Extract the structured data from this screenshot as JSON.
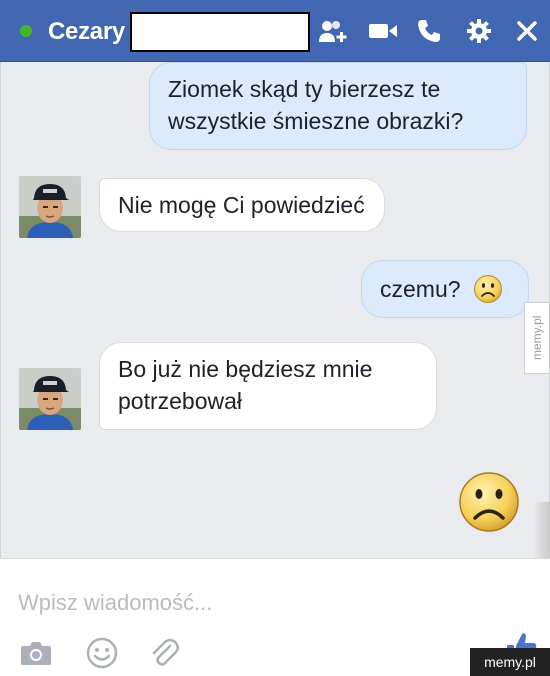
{
  "header": {
    "contact_name": "Cezary",
    "status": "online",
    "icons": [
      "add-person-icon",
      "video-camera-icon",
      "phone-icon",
      "gear-icon",
      "close-icon"
    ],
    "colors": {
      "bar": "#4267b2",
      "online": "#42b72a"
    }
  },
  "messages": [
    {
      "direction": "out",
      "text_line1": "Ziomek skąd ty bierzesz te",
      "text_line2": "wszystkie śmieszne obrazki?"
    },
    {
      "direction": "in",
      "text": "Nie mogę Ci powiedzieć"
    },
    {
      "direction": "out",
      "text": "czemu?",
      "emoji": "sad-face"
    },
    {
      "direction": "in",
      "text_line1": "Bo już nie będziesz mnie",
      "text_line2": "potrzebował"
    },
    {
      "direction": "out",
      "emoji": "sad-face-large"
    }
  ],
  "composer": {
    "placeholder": "Wpisz wiadomość...",
    "value": "",
    "icons": [
      "camera-icon",
      "smiley-icon",
      "paperclip-icon",
      "thumbs-up-icon"
    ]
  },
  "watermarks": {
    "side": "memy.pl",
    "corner": "memy.pl"
  }
}
